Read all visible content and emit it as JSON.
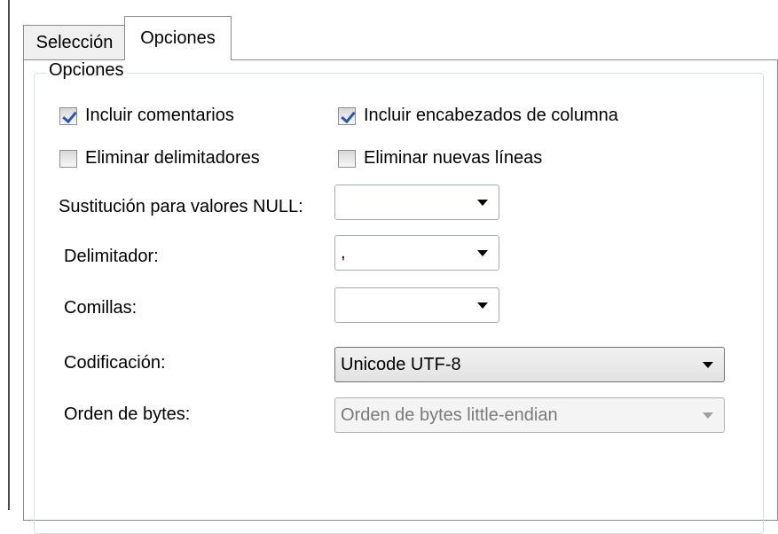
{
  "tabs": [
    {
      "label": "Selección",
      "active": false
    },
    {
      "label": "Opciones",
      "active": true
    }
  ],
  "group": {
    "label": "Opciones"
  },
  "checkboxes": {
    "include_comments": {
      "label": "Incluir comentarios",
      "checked": true
    },
    "include_headers": {
      "label": "Incluir encabezados de columna",
      "checked": true
    },
    "remove_delimiters": {
      "label": "Eliminar delimitadores",
      "checked": false
    },
    "remove_newlines": {
      "label": "Eliminar nuevas líneas",
      "checked": false
    }
  },
  "fields": {
    "null_replacement": {
      "label": "Sustitución para valores NULL:",
      "value": ""
    },
    "delimiter": {
      "label": "Delimitador:",
      "value": ","
    },
    "quotes": {
      "label": "Comillas:",
      "value": ""
    },
    "encoding": {
      "label": "Codificación:",
      "value": "Unicode UTF-8"
    },
    "byte_order": {
      "label": "Orden de bytes:",
      "value": "Orden de bytes little-endian",
      "disabled": true
    }
  }
}
